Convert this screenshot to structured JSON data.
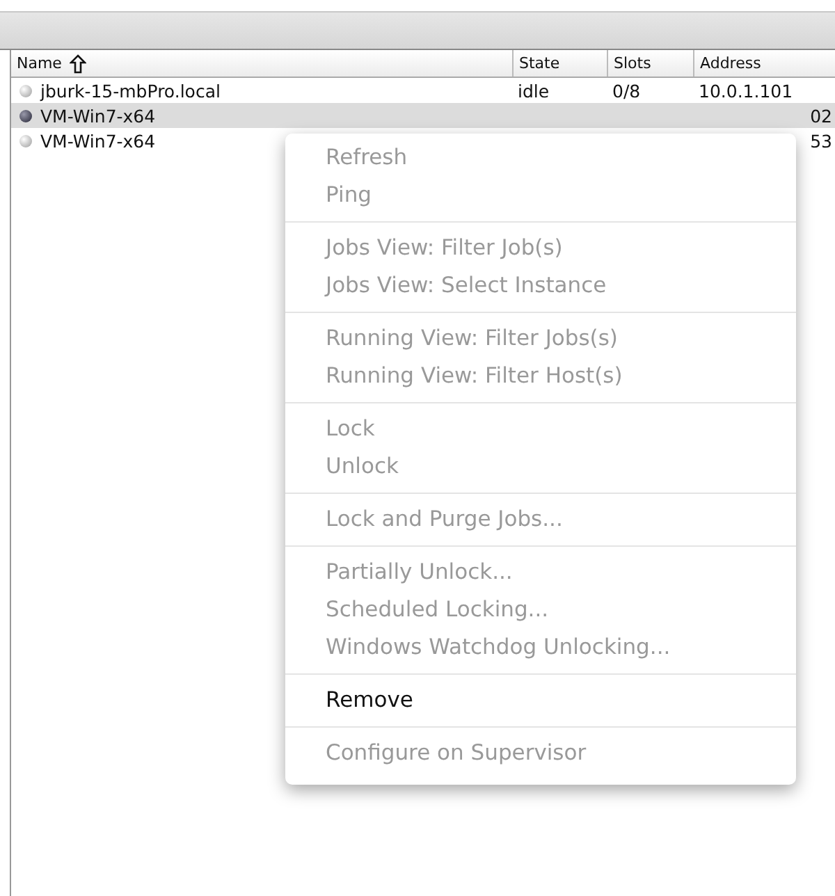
{
  "table": {
    "columns": [
      {
        "label": "Name",
        "sorted": true
      },
      {
        "label": "State",
        "sorted": false
      },
      {
        "label": "Slots",
        "sorted": false
      },
      {
        "label": "Address",
        "sorted": false
      }
    ],
    "rows": [
      {
        "name": "jburk-15-mbPro.local",
        "state": "idle",
        "slots": "0/8",
        "address": "10.0.1.101",
        "selected": false
      },
      {
        "name": "VM-Win7-x64",
        "address": "02",
        "selected": true
      },
      {
        "name": "VM-Win7-x64",
        "address": "53",
        "selected": false
      }
    ]
  },
  "context_menu": {
    "groups": [
      [
        {
          "label": "Refresh",
          "disabled": true
        },
        {
          "label": "Ping",
          "disabled": true
        }
      ],
      [
        {
          "label": "Jobs View: Filter Job(s)",
          "disabled": true
        },
        {
          "label": "Jobs View: Select Instance",
          "disabled": true
        }
      ],
      [
        {
          "label": "Running View: Filter Jobs(s)",
          "disabled": true
        },
        {
          "label": "Running View: Filter Host(s)",
          "disabled": true
        }
      ],
      [
        {
          "label": "Lock",
          "disabled": true
        },
        {
          "label": "Unlock",
          "disabled": true
        }
      ],
      [
        {
          "label": "Lock and Purge Jobs...",
          "disabled": true
        }
      ],
      [
        {
          "label": "Partially Unlock...",
          "disabled": true
        },
        {
          "label": "Scheduled Locking...",
          "disabled": true
        },
        {
          "label": "Windows Watchdog Unlocking...",
          "disabled": true
        }
      ],
      [
        {
          "label": "Remove",
          "disabled": false
        }
      ],
      [
        {
          "label": "Configure on Supervisor",
          "disabled": true
        }
      ]
    ]
  }
}
